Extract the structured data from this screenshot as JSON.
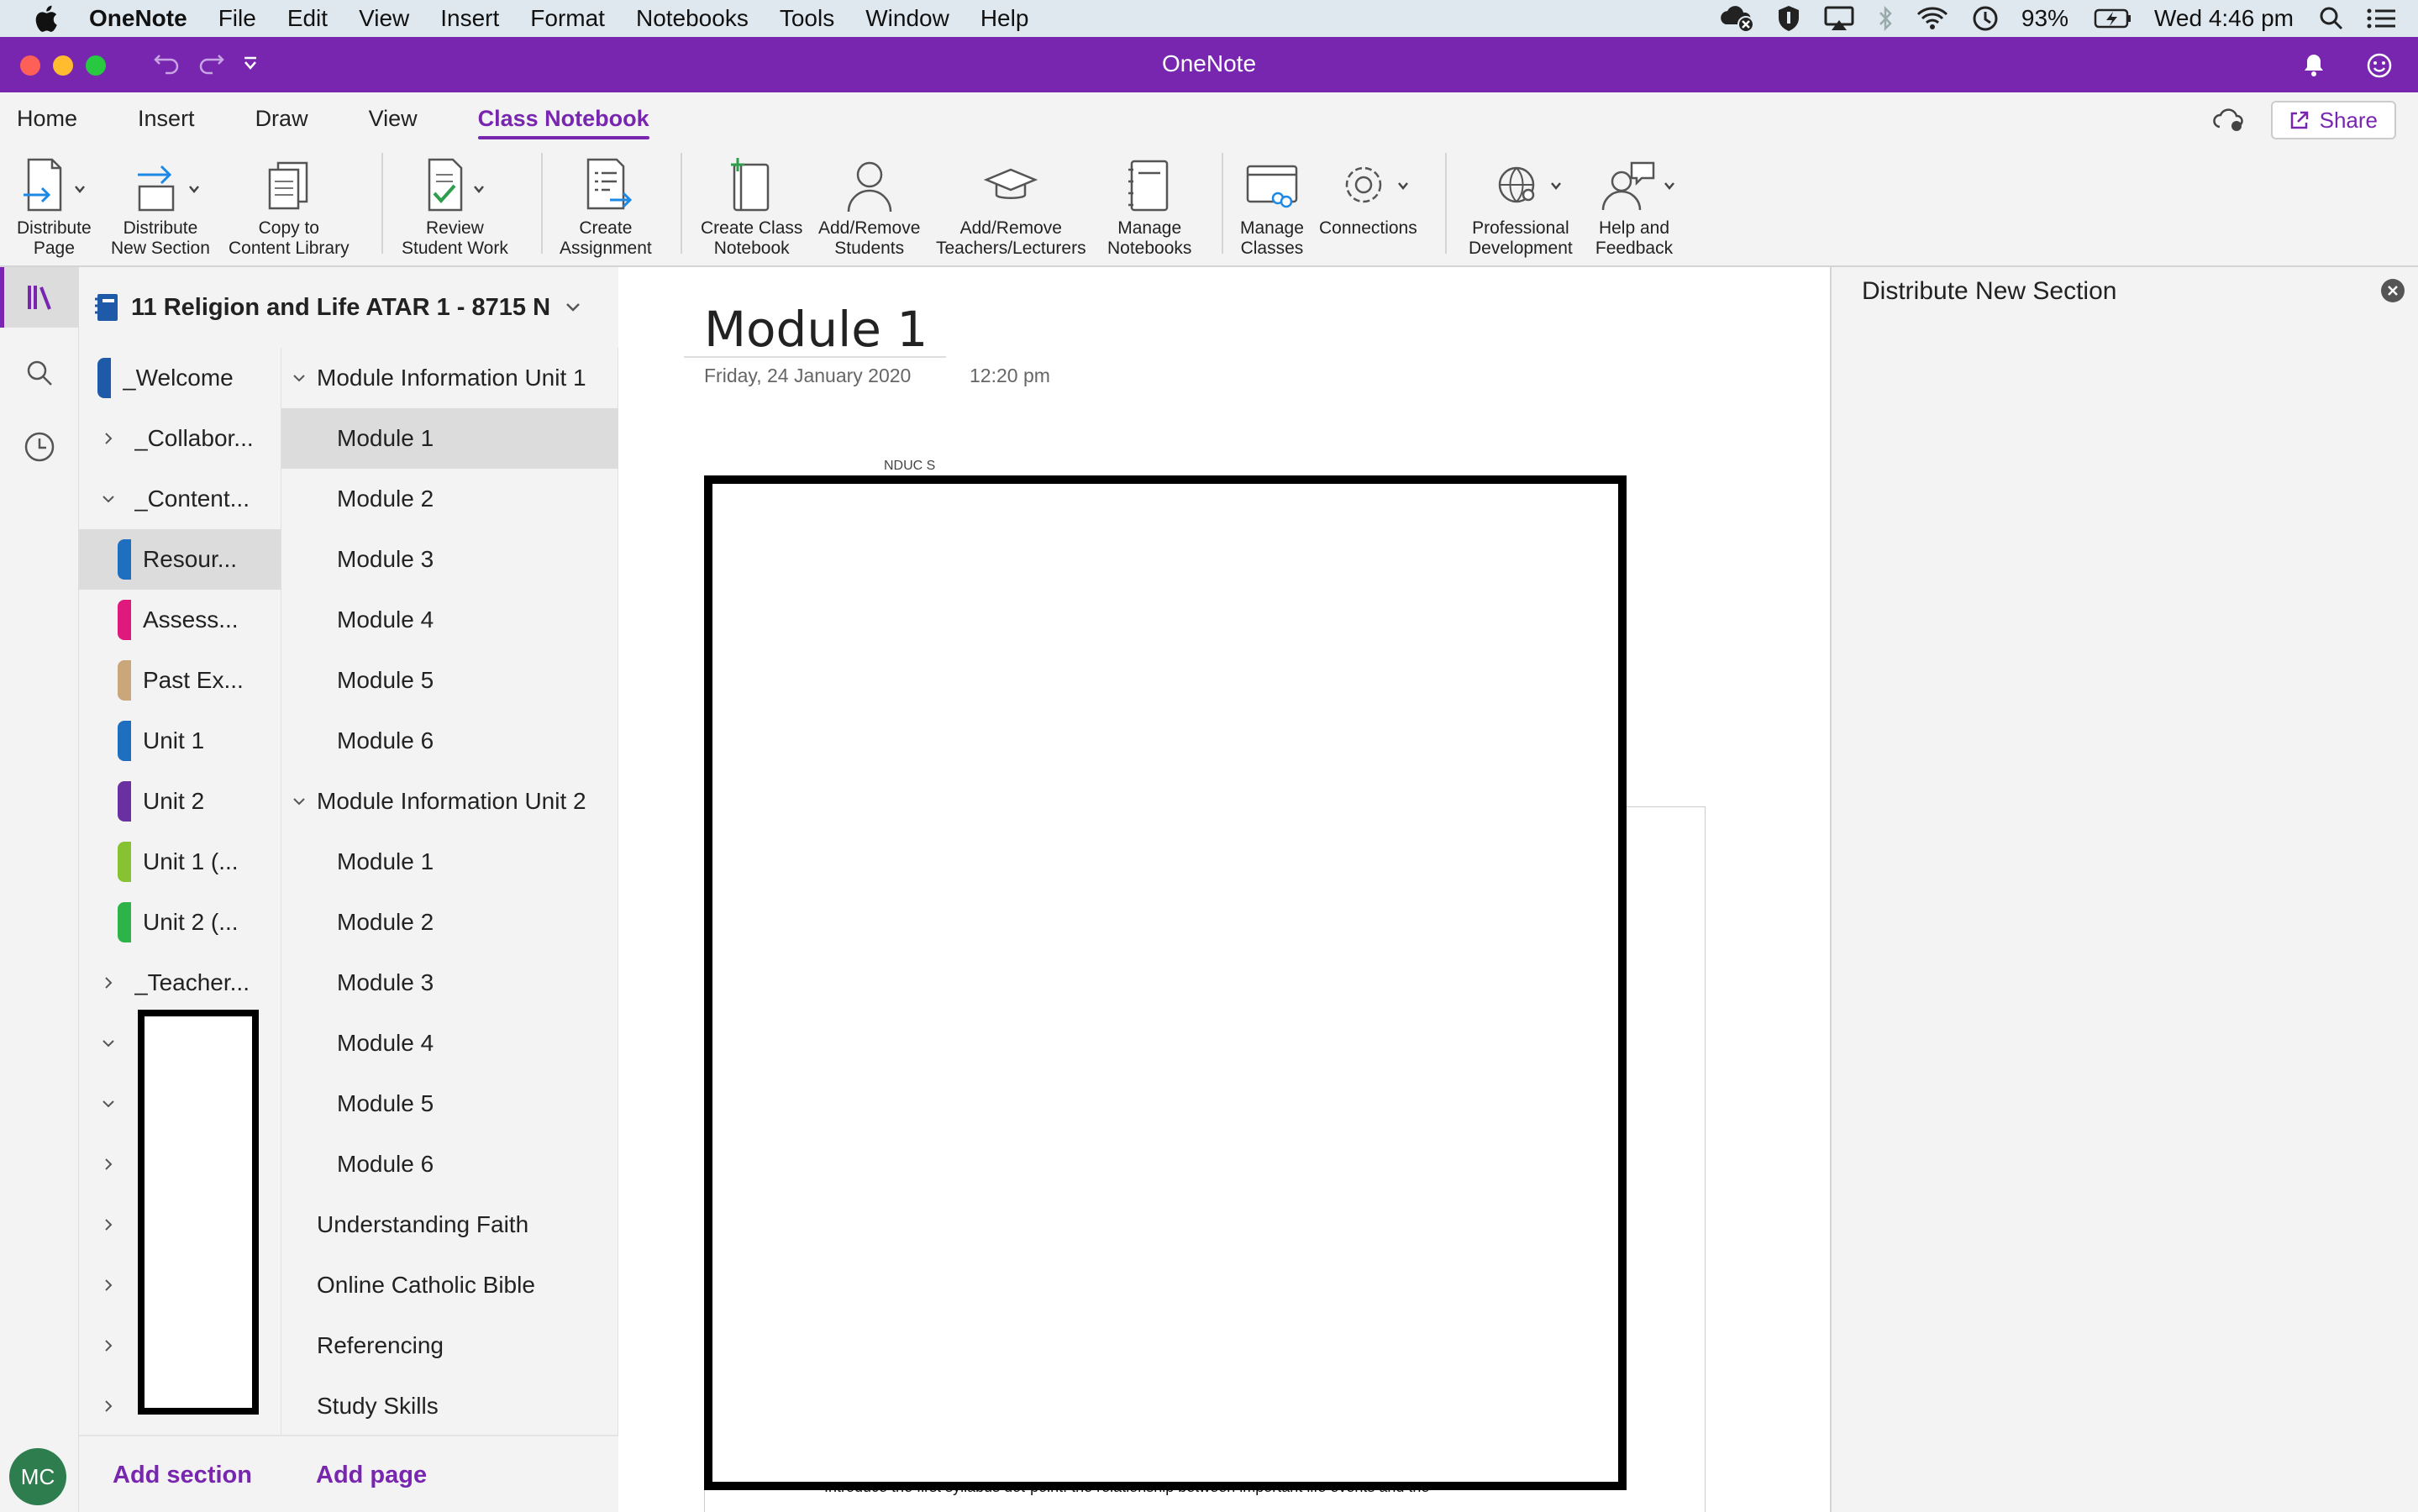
{
  "menubar": {
    "app_name": "OneNote",
    "menus": [
      "File",
      "Edit",
      "View",
      "Insert",
      "Format",
      "Notebooks",
      "Tools",
      "Window",
      "Help"
    ],
    "battery": "93%",
    "clock": "Wed 4:46 pm"
  },
  "window": {
    "title": "OneNote"
  },
  "tabs": {
    "items": [
      "Home",
      "Insert",
      "Draw",
      "View",
      "Class Notebook"
    ],
    "active": "Class Notebook",
    "share_label": "Share"
  },
  "ribbon": {
    "distribute_page": "Distribute\nPage",
    "distribute_section": "Distribute\nNew Section",
    "copy_library": "Copy to\nContent Library",
    "review_work": "Review\nStudent Work",
    "create_assignment": "Create\nAssignment",
    "create_notebook": "Create Class\nNotebook",
    "add_students": "Add/Remove\nStudents",
    "add_teachers": "Add/Remove\nTeachers/Lecturers",
    "manage_notebooks": "Manage\nNotebooks",
    "manage_classes": "Manage\nClasses",
    "connections": "Connections",
    "prof_dev": "Professional\nDevelopment",
    "help_feedback": "Help and\nFeedback"
  },
  "notebook": {
    "title": "11 Religion and Life ATAR 1 - 8715 N..."
  },
  "sections": [
    {
      "name": "_Welcome",
      "color": "#1e5aa8"
    },
    {
      "name": "_Collabor...",
      "color": ""
    },
    {
      "name": "_Content...",
      "color": ""
    },
    {
      "name": "Resour...",
      "color": "#1e6fc0"
    },
    {
      "name": "Assess...",
      "color": "#e0197d"
    },
    {
      "name": "Past Ex...",
      "color": "#c9a77a"
    },
    {
      "name": "Unit 1",
      "color": "#1e6fc0"
    },
    {
      "name": "Unit 2",
      "color": "#6a2fa0"
    },
    {
      "name": "Unit 1 (...",
      "color": "#86c232"
    },
    {
      "name": "Unit 2 (...",
      "color": "#2db34a"
    },
    {
      "name": "_Teacher...",
      "color": ""
    }
  ],
  "pages": [
    "Module Information Unit 1",
    "Module 1",
    "Module 2",
    "Module 3",
    "Module 4",
    "Module 5",
    "Module 6",
    "Module Information Unit 2",
    "Module 1",
    "Module 2",
    "Module 3",
    "Module 4",
    "Module 5",
    "Module 6",
    "Understanding Faith",
    "Online Catholic Bible",
    "Referencing",
    "Study Skills"
  ],
  "add": {
    "section": "Add section",
    "page": "Add page"
  },
  "page": {
    "title": "Module 1",
    "date": "Friday, 24 January 2020",
    "time": "12:20 pm",
    "partial_text": "NDUC S",
    "bullet_text": "Introduce the first syllabus dot-point: the relationship between important life events and the"
  },
  "pane": {
    "title": "Distribute New Section"
  },
  "user": {
    "initials": "MC"
  }
}
